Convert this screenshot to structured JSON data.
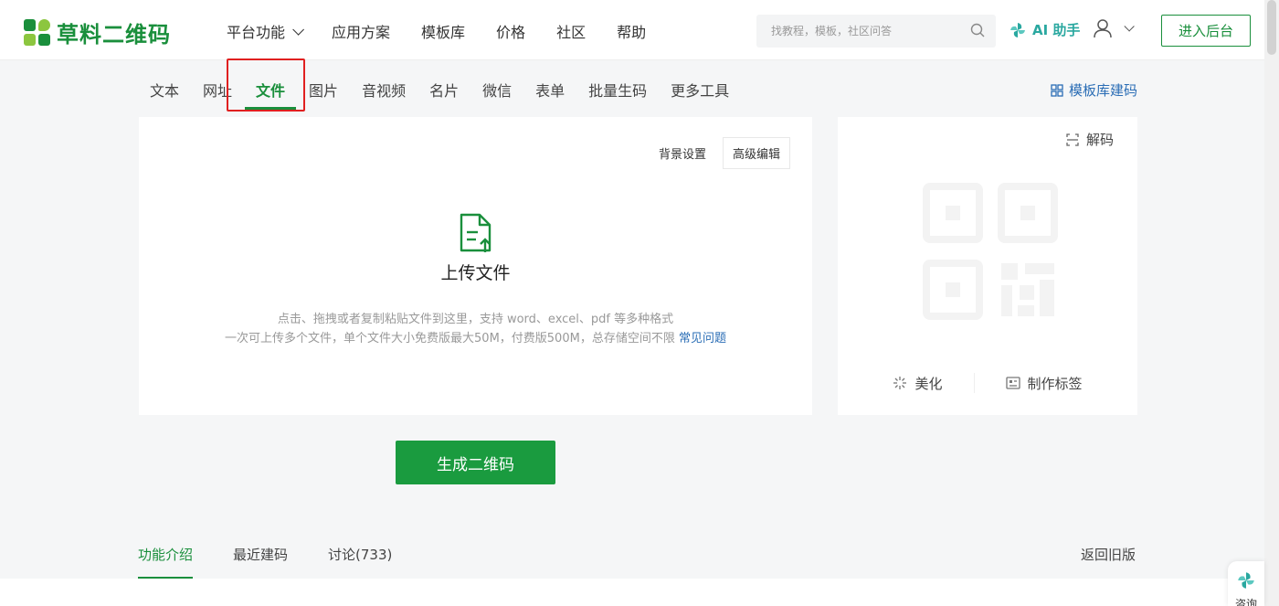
{
  "brand": {
    "name": "草料二维码"
  },
  "nav": {
    "items": [
      {
        "label": "平台功能"
      },
      {
        "label": "应用方案"
      },
      {
        "label": "模板库"
      },
      {
        "label": "价格"
      },
      {
        "label": "社区"
      },
      {
        "label": "帮助"
      }
    ]
  },
  "search": {
    "placeholder": "找教程，模板，社区问答"
  },
  "ai_helper": {
    "label": "AI 助手"
  },
  "enter_backend": {
    "label": "进入后台"
  },
  "type_tabs": [
    {
      "label": "文本"
    },
    {
      "label": "网址"
    },
    {
      "label": "文件"
    },
    {
      "label": "图片"
    },
    {
      "label": "音视频"
    },
    {
      "label": "名片"
    },
    {
      "label": "微信"
    },
    {
      "label": "表单"
    },
    {
      "label": "批量生码"
    },
    {
      "label": "更多工具"
    }
  ],
  "template_link": {
    "label": "模板库建码"
  },
  "upload": {
    "bg_setting": "背景设置",
    "advanced_edit": "高级编辑",
    "title": "上传文件",
    "hint_line1": "点击、拖拽或者复制粘贴文件到这里，支持 word、excel、pdf 等多种格式",
    "hint_line2": "一次可上传多个文件，单个文件大小免费版最大50M，付费版500M，总存储空间不限 ",
    "faq": "常见问题"
  },
  "preview": {
    "decode": "解码",
    "beautify": "美化",
    "make_label": "制作标签"
  },
  "generate": {
    "label": "生成二维码"
  },
  "bottom_tabs": [
    {
      "label": "功能介绍"
    },
    {
      "label": "最近建码"
    },
    {
      "label": "讨论(733)"
    }
  ],
  "old_version": {
    "label": "返回旧版"
  },
  "consult": {
    "label": "咨询"
  },
  "colors": {
    "brand_green": "#1a8f3c",
    "link_blue": "#2a6db5",
    "highlight_red": "#e02020"
  }
}
